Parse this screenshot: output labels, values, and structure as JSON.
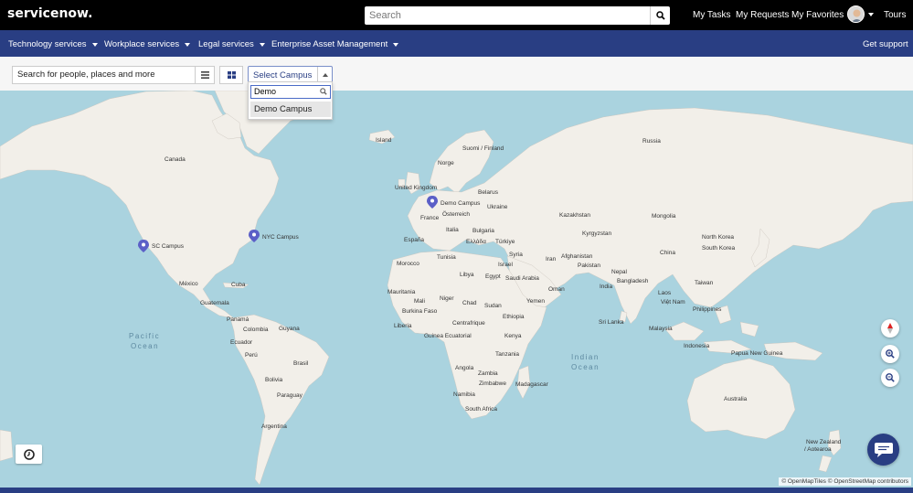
{
  "header": {
    "logo": "servicenow.",
    "search_placeholder": "Search",
    "links": [
      "My Tasks",
      "My Requests",
      "My Favorites",
      "Tours"
    ]
  },
  "nav": {
    "items": [
      "Technology services",
      "Workplace services",
      "Legal services",
      "Enterprise Asset Management"
    ],
    "get_support": "Get support"
  },
  "toolbar": {
    "people_search": "Search for people, places and more",
    "campus_select": "Select Campus",
    "campus_filter_value": "Demo",
    "campus_options": [
      "Demo Campus"
    ]
  },
  "map": {
    "campus_markers": [
      "Demo Campus",
      "NYC Campus",
      "SC Campus"
    ],
    "marker_color": "#5b5fc7",
    "oceans": [
      "Pacific",
      "Ocean",
      "Indian",
      "Ocean"
    ],
    "countries": [
      "Island",
      "Suomi / Finland",
      "Russia",
      "Canada",
      "Norge",
      "United Kingdom",
      "Belarus",
      "Ukraine",
      "France",
      "Österreich",
      "Kazakhstan",
      "Mongolia",
      "España",
      "Italia",
      "Bulgaria",
      "Kyrgyzstan",
      "North Korea",
      "South Korea",
      "Ελλάδα",
      "Türkiye",
      "Syria",
      "Afghanistan",
      "China",
      "Morocco",
      "Tunisia",
      "Iran",
      "Pakistan",
      "Israel",
      "Libya",
      "Egypt",
      "Saudi Arabia",
      "Nepal",
      "Bangladesh",
      "Taiwan",
      "México",
      "Cuba",
      "Oman",
      "India",
      "Laos",
      "Mauritania",
      "Niger",
      "Mali",
      "Chad",
      "Sudan",
      "Yemen",
      "Việt Nam",
      "Philippines",
      "Guatemala",
      "Burkina Faso",
      "Ethiopia",
      "Sri Lanka",
      "Panamá",
      "Colombia",
      "Guyana",
      "Liberia",
      "Centrafrique",
      "Malaysia",
      "Ecuador",
      "Guinea Ecuatorial",
      "Kenya",
      "Indonesia",
      "Papua New Guinea",
      "Perú",
      "Brasil",
      "Tanzania",
      "Angola",
      "Zambia",
      "Bolivia",
      "Zimbabwe",
      "Madagascar",
      "Paraguay",
      "Namibia",
      "Australia",
      "South Africa",
      "Argentina",
      "New Zealand",
      "/ Aotearoa"
    ],
    "attribution": "© OpenMapTiles © OpenStreetMap contributors",
    "land_color": "#f2efe9",
    "water_color": "#aad3df"
  },
  "accent": "#293e83"
}
